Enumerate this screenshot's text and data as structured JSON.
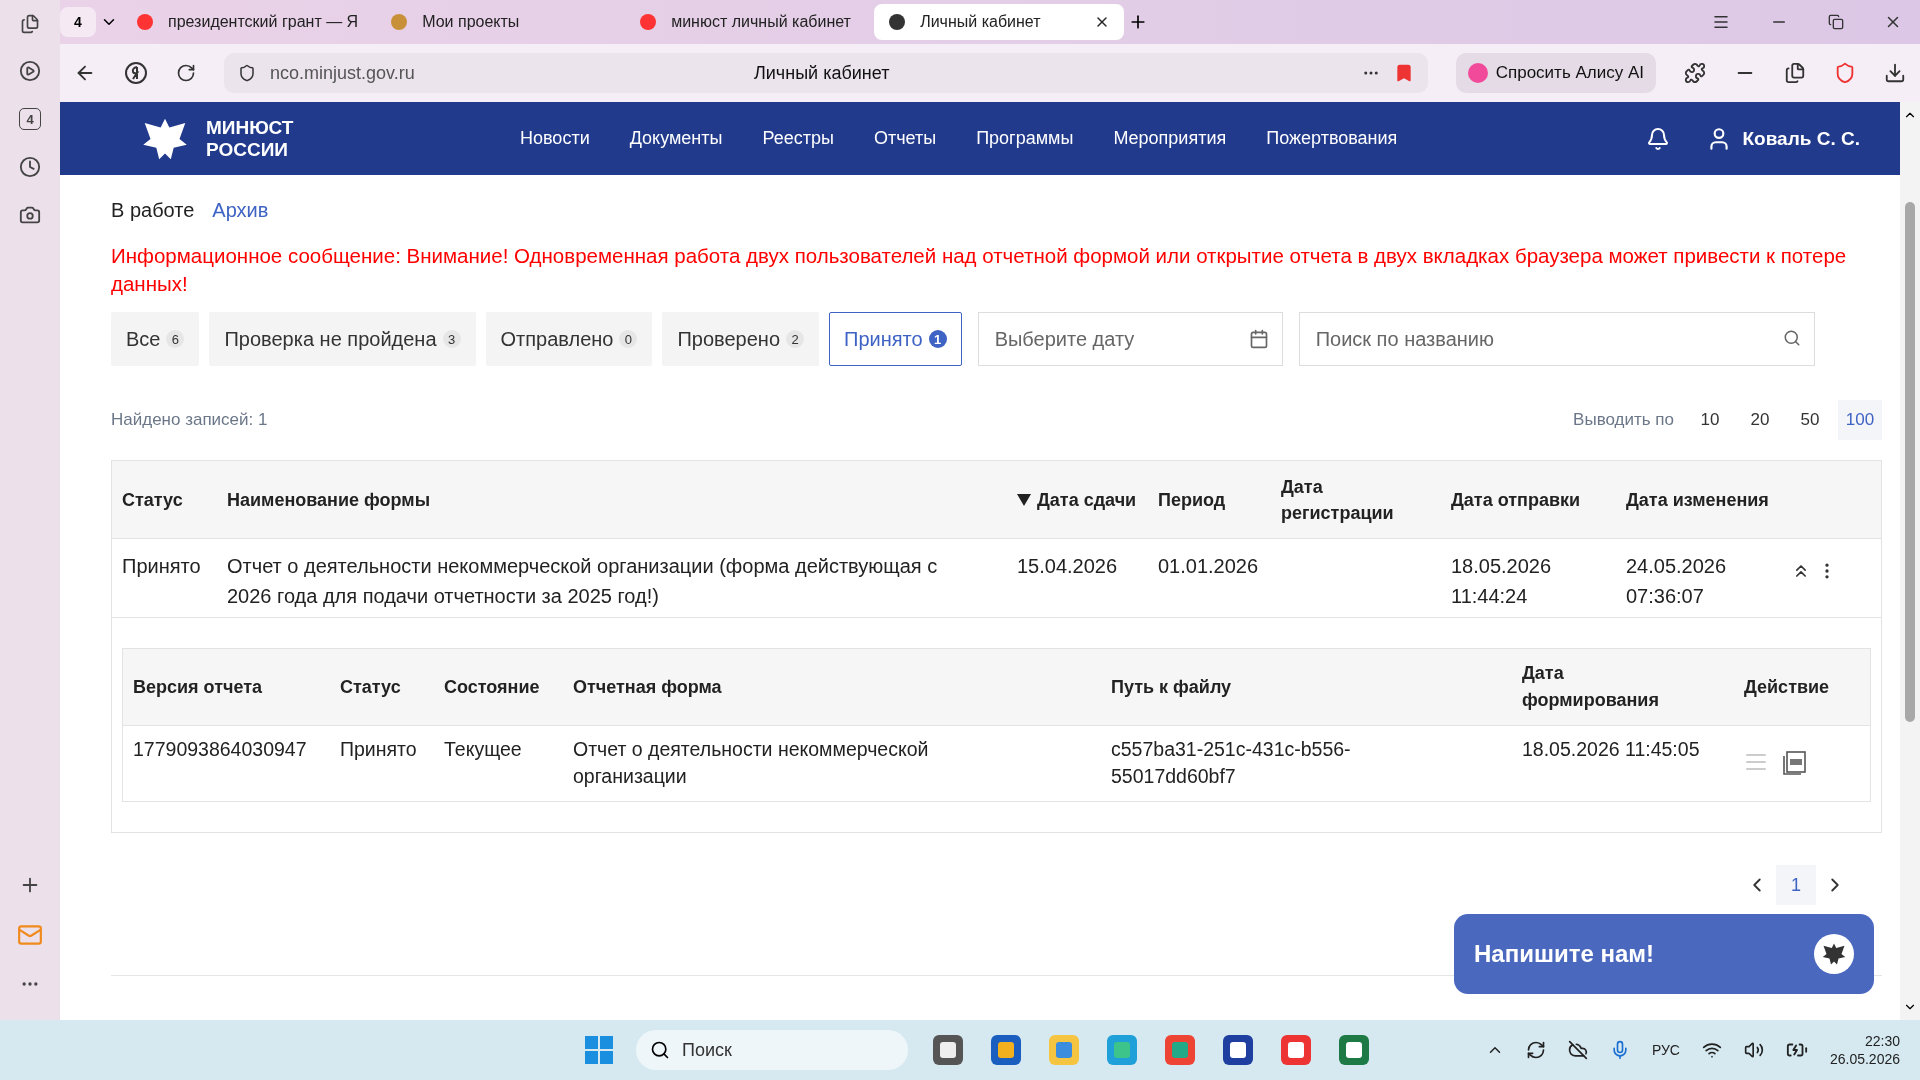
{
  "browser": {
    "tab_count": "4",
    "tabs": [
      {
        "title": "президентский грант — Я",
        "selected": false
      },
      {
        "title": "Мои проекты",
        "selected": false
      },
      {
        "title": "минюст личный кабинет",
        "selected": false
      },
      {
        "title": "Личный кабинет",
        "selected": true
      }
    ],
    "address": "nco.minjust.gov.ru",
    "page_title": "Личный кабинет",
    "alice_button": "Спросить Алису AI",
    "sidebar_badge": "4"
  },
  "site": {
    "logo_lines": [
      "МИНЮСТ",
      "РОССИИ"
    ],
    "nav": [
      "Новости",
      "Документы",
      "Реестры",
      "Отчеты",
      "Программы",
      "Мероприятия",
      "Пожертвования"
    ],
    "user": "Коваль С. С."
  },
  "view_tabs": [
    {
      "label": "В работе",
      "selected": true
    },
    {
      "label": "Архив",
      "selected": false
    }
  ],
  "notice": "Информационное сообщение: Внимание! Одновременная работа двух пользователей над отчетной формой или открытие отчета в двух вкладках браузера может привести к потере данных!",
  "filters": [
    {
      "label": "Все",
      "count": "6",
      "selected": false
    },
    {
      "label": "Проверка не пройдена",
      "count": "3",
      "selected": false
    },
    {
      "label": "Отправлено",
      "count": "0",
      "selected": false
    },
    {
      "label": "Проверено",
      "count": "2",
      "selected": false
    },
    {
      "label": "Принято",
      "count": "1",
      "selected": true
    }
  ],
  "date_field": {
    "placeholder": "Выберите дату"
  },
  "search_field": {
    "placeholder": "Поиск по названию"
  },
  "found": "Найдено записей: 1",
  "page_size": {
    "label": "Выводить по",
    "options": [
      {
        "label": "10",
        "selected": false
      },
      {
        "label": "20",
        "selected": false
      },
      {
        "label": "50",
        "selected": false
      },
      {
        "label": "100",
        "selected": true
      }
    ]
  },
  "table": {
    "columns": [
      {
        "label": "Статус",
        "sorted": false
      },
      {
        "label": "Наименование формы",
        "sorted": false
      },
      {
        "label": "Дата сдачи",
        "sorted": true
      },
      {
        "label": "Период",
        "sorted": false
      },
      {
        "label": "Дата регистрации",
        "sorted": false
      },
      {
        "label": "Дата отправки",
        "sorted": false
      },
      {
        "label": "Дата изменения",
        "sorted": false
      }
    ],
    "rows": [
      {
        "cells": [
          "Принято",
          "Отчет о деятельности некоммерческой организации (форма действующая с 2026 года для подачи отчетности за 2025 год!)",
          "15.04.2026",
          "01.01.2026",
          "",
          "18.05.2026 11:44:24",
          "24.05.2026 07:36:07"
        ],
        "expanded": true,
        "versions": {
          "columns": [
            "Версия отчета",
            "Статус",
            "Состояние",
            "Отчетная форма",
            "Путь к файлу",
            "Дата формирования",
            "Действие"
          ],
          "rows": [
            {
              "cells": [
                "1779093864030947",
                "Принято",
                "Текущее",
                "Отчет о деятельности некоммерческой организации",
                "c557ba31-251c-431c-b556-55017dd60bf7",
                "18.05.2026 11:45:05"
              ]
            }
          ]
        }
      }
    ]
  },
  "pagination": {
    "pages": [
      {
        "label": "1",
        "selected": true
      }
    ]
  },
  "chat_button": "Напишите нам!",
  "taskbar": {
    "search_placeholder": "Поиск",
    "language": "РУС",
    "time": "22:30",
    "date": "26.05.2026"
  }
}
